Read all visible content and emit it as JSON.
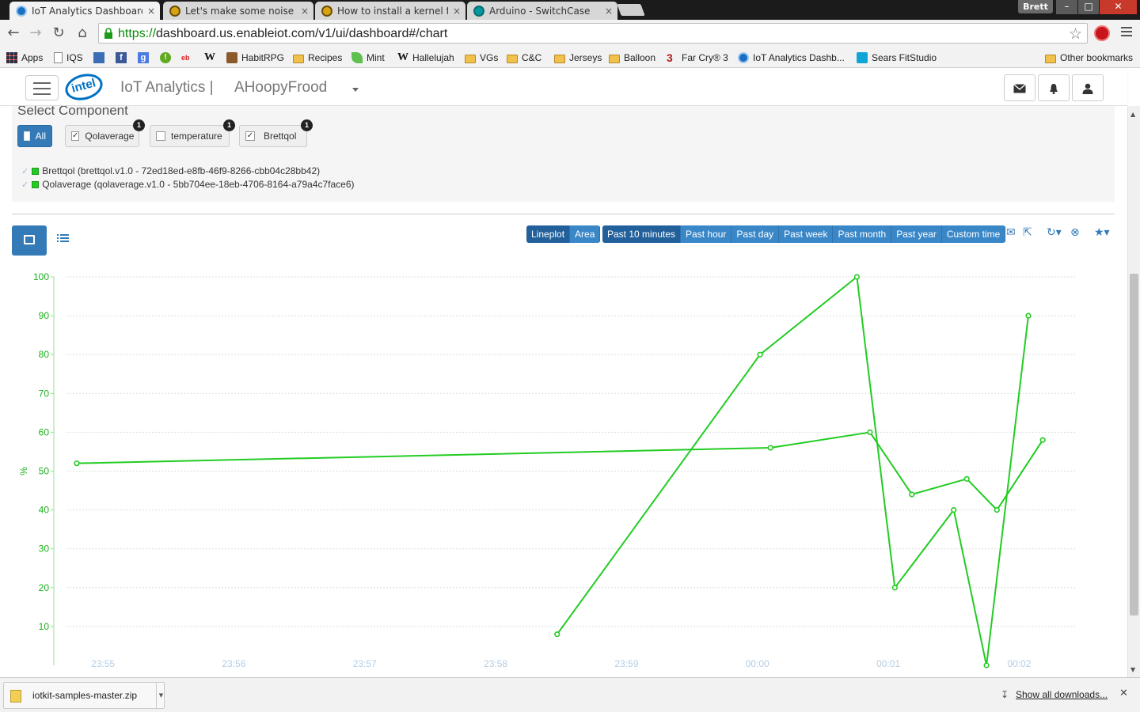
{
  "tabs": [
    {
      "title": "IoT Analytics Dashboard",
      "close": "×",
      "favicon": "blue"
    },
    {
      "title": "Let's make some noise (or",
      "close": "×",
      "favicon": "gold"
    },
    {
      "title": "How to install a kernel fro",
      "close": "×",
      "favicon": "gold"
    },
    {
      "title": "Arduino - SwitchCase",
      "close": "×",
      "favicon": "teal"
    }
  ],
  "window": {
    "user": "Brett",
    "minimize": "–",
    "maximize": "□",
    "close": "✕"
  },
  "address_bar": {
    "scheme": "https://",
    "url_rest": "dashboard.us.enableiot.com/v1/ui/dashboard#/chart"
  },
  "bookmarks": [
    {
      "label": "Apps",
      "icon": "apps-grid-icon"
    },
    {
      "label": "IQS",
      "icon": "page-icon"
    },
    {
      "label": "",
      "icon": "mail-icon"
    },
    {
      "label": "",
      "icon": "facebook-icon"
    },
    {
      "label": "",
      "icon": "google-plus-icon"
    },
    {
      "label": "",
      "icon": "alert-icon"
    },
    {
      "label": "",
      "icon": "ebay-icon"
    },
    {
      "label": "",
      "icon": "wikipedia-icon"
    },
    {
      "label": "HabitRPG",
      "icon": "habitrpg-icon"
    },
    {
      "label": "Recipes",
      "icon": "folder-icon"
    },
    {
      "label": "Mint",
      "icon": "mint-icon"
    },
    {
      "label": "Hallelujah",
      "icon": "wikipedia-icon"
    },
    {
      "label": "VGs",
      "icon": "folder-icon"
    },
    {
      "label": "C&C",
      "icon": "folder-icon"
    },
    {
      "label": "Jerseys",
      "icon": "folder-icon"
    },
    {
      "label": "Balloon",
      "icon": "folder-icon"
    },
    {
      "label": "Far Cry® 3",
      "icon": "farcry-icon"
    },
    {
      "label": "IoT Analytics Dashb...",
      "icon": "iot-icon"
    },
    {
      "label": "Sears FitStudio",
      "icon": "sears-icon"
    },
    {
      "label": "Other bookmarks",
      "icon": "folder-icon"
    }
  ],
  "header": {
    "logo": "intel",
    "title": "IoT Analytics |",
    "account": "AHoopyFrood",
    "icons": [
      "envelope-icon",
      "bell-icon",
      "user-icon"
    ]
  },
  "components": {
    "title": "Select Component",
    "all_label": "All",
    "items": [
      {
        "label": "Qolaverage",
        "checked": true,
        "count": "1"
      },
      {
        "label": "temperature",
        "checked": false,
        "count": "1"
      },
      {
        "label": "Brettqol",
        "checked": true,
        "count": "1"
      }
    ],
    "legend": [
      {
        "text": "Brettqol (brettqol.v1.0 - 72ed18ed-e8fb-46f9-8266-cbb04c28bb42)",
        "color": "#22cc22"
      },
      {
        "text": "Qolaverage (qolaverage.v1.0 - 5bb704ee-18eb-4706-8164-a79a4c7face6)",
        "color": "#22cc22"
      }
    ]
  },
  "toolbar": {
    "chart_types": [
      {
        "label": "Lineplot",
        "active": true
      },
      {
        "label": "Area",
        "active": false
      }
    ],
    "ranges": [
      {
        "label": "Past 10 minutes",
        "active": true
      },
      {
        "label": "Past hour",
        "active": false
      },
      {
        "label": "Past day",
        "active": false
      },
      {
        "label": "Past week",
        "active": false
      },
      {
        "label": "Past month",
        "active": false
      },
      {
        "label": "Past year",
        "active": false
      },
      {
        "label": "Custom time",
        "active": false
      }
    ],
    "icons": [
      "email-icon",
      "export-icon",
      "refresh-icon",
      "clear-icon",
      "favorite-star-icon"
    ]
  },
  "chart_data": {
    "type": "line",
    "title": "",
    "xlabel": "",
    "ylabel": "%",
    "ylim": [
      0,
      100
    ],
    "yticks": [
      10,
      20,
      30,
      40,
      50,
      60,
      70,
      80,
      90,
      100
    ],
    "xticks": [
      "23:55",
      "23:56",
      "23:57",
      "23:58",
      "23:59",
      "00:00",
      "00:01",
      "00:02"
    ],
    "x_start_label": "23:55",
    "x_minutes_range": [
      -0.2,
      7.3
    ],
    "line_color": "#22cc22",
    "grid": true,
    "legend": "none",
    "series": [
      {
        "name": "Brettqol",
        "points": [
          {
            "t": 3.47,
            "y": 8
          },
          {
            "t": 5.02,
            "y": 80
          },
          {
            "t": 5.76,
            "y": 100
          },
          {
            "t": 6.05,
            "y": 20
          },
          {
            "t": 6.5,
            "y": 40
          },
          {
            "t": 6.75,
            "y": 0
          },
          {
            "t": 7.07,
            "y": 90
          }
        ]
      },
      {
        "name": "Qolaverage",
        "points": [
          {
            "t": -0.2,
            "y": 52
          },
          {
            "t": 5.1,
            "y": 56
          },
          {
            "t": 5.86,
            "y": 60
          },
          {
            "t": 6.18,
            "y": 44
          },
          {
            "t": 6.6,
            "y": 48
          },
          {
            "t": 6.83,
            "y": 40
          },
          {
            "t": 7.18,
            "y": 58
          }
        ]
      }
    ]
  },
  "downloads": {
    "file": "iotkit-samples-master.zip",
    "show_all": "Show all downloads...",
    "close": "✕"
  }
}
